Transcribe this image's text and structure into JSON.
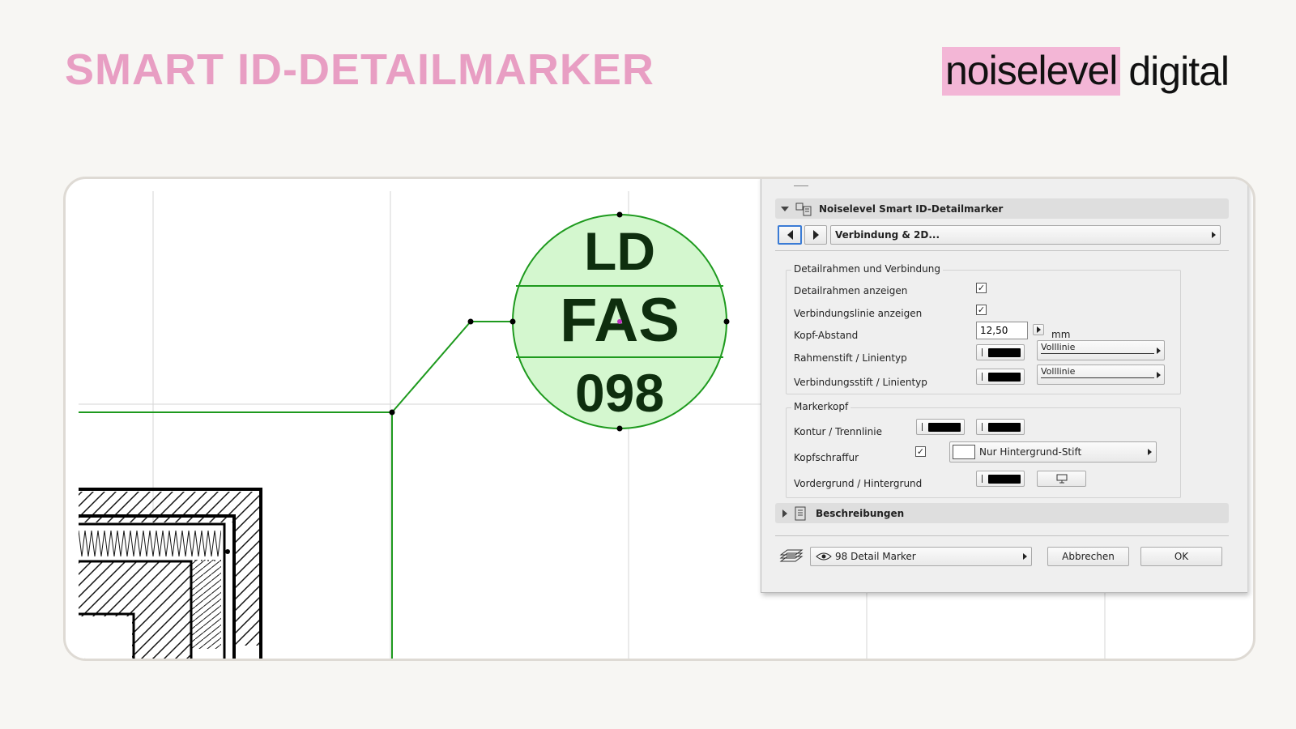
{
  "header": {
    "title": "SMART ID-DETAILMARKER"
  },
  "logo": {
    "highlight": "noiselevel",
    "rest": "digital"
  },
  "marker": {
    "line1": "LD",
    "line2": "FAS",
    "line3": "098"
  },
  "dialog": {
    "header_title": "Noiselevel Smart ID-Detailmarker",
    "page_selector": "Verbindung & 2D...",
    "group1": {
      "title": "Detailrahmen und Verbindung",
      "show_frame": "Detailrahmen anzeigen",
      "show_line": "Verbindungslinie anzeigen",
      "head_distance": "Kopf-Abstand",
      "head_distance_value": "12,50",
      "unit": "mm",
      "frame_pen": "Rahmenstift / Linientyp",
      "frame_linetype": "Volllinie",
      "conn_pen": "Verbindungsstift / Linientyp",
      "conn_linetype": "Volllinie"
    },
    "group2": {
      "title": "Markerkopf",
      "contour": "Kontur / Trennlinie",
      "hatch": "Kopfschraffur",
      "hatch_value": "Nur Hintergrund-Stift",
      "fg_bg": "Vordergrund / Hintergrund"
    },
    "descriptions": "Beschreibungen",
    "footer": {
      "layer": "98 Detail Marker",
      "cancel": "Abbrechen",
      "ok": "OK"
    }
  },
  "colors": {
    "title": "#e89ec3",
    "logo_highlight": "#f3b6d6",
    "marker_fill": "#d4f7cf",
    "marker_stroke": "#1e9a1e"
  }
}
